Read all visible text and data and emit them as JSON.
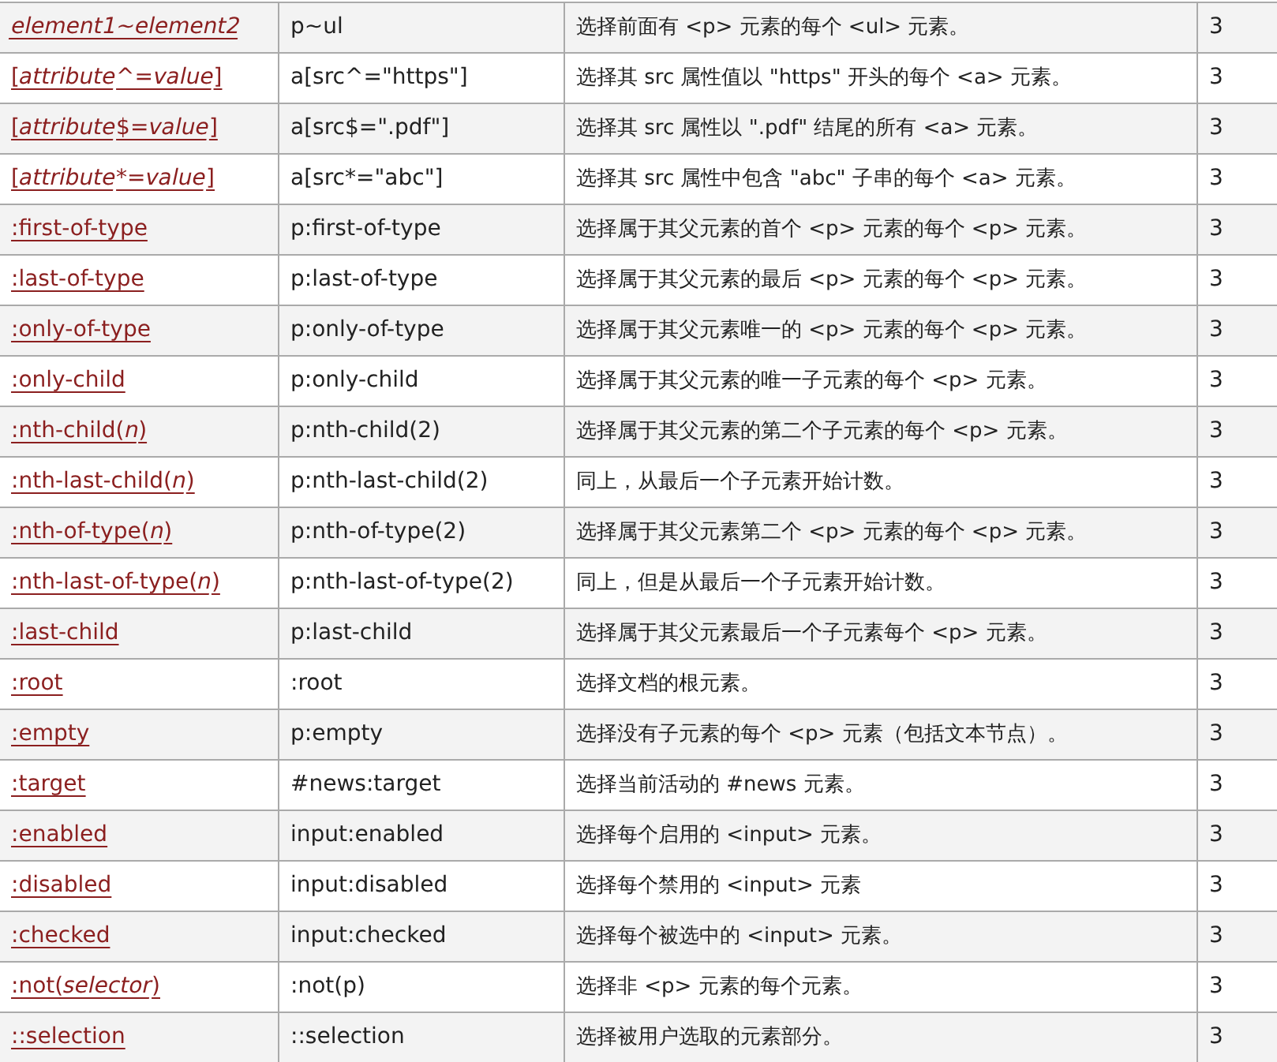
{
  "table": {
    "rows": [
      {
        "selector": [
          {
            "text": "element1~element2",
            "italic": true
          }
        ],
        "example": "p~ul",
        "description": "选择前面有 <p> 元素的每个 <ul> 元素。",
        "version": "3"
      },
      {
        "selector": [
          {
            "text": "[",
            "italic": false
          },
          {
            "text": "attribute",
            "italic": true
          },
          {
            "text": "^=",
            "italic": false
          },
          {
            "text": "value",
            "italic": true
          },
          {
            "text": "]",
            "italic": false
          }
        ],
        "example": "a[src^=\"https\"]",
        "description": "选择其 src 属性值以 \"https\" 开头的每个 <a> 元素。",
        "version": "3"
      },
      {
        "selector": [
          {
            "text": "[",
            "italic": false
          },
          {
            "text": "attribute",
            "italic": true
          },
          {
            "text": "$=",
            "italic": false
          },
          {
            "text": "value",
            "italic": true
          },
          {
            "text": "]",
            "italic": false
          }
        ],
        "example": "a[src$=\".pdf\"]",
        "description": "选择其 src 属性以 \".pdf\" 结尾的所有 <a> 元素。",
        "version": "3"
      },
      {
        "selector": [
          {
            "text": "[",
            "italic": false
          },
          {
            "text": "attribute",
            "italic": true
          },
          {
            "text": "*=",
            "italic": false
          },
          {
            "text": "value",
            "italic": true
          },
          {
            "text": "]",
            "italic": false
          }
        ],
        "example": "a[src*=\"abc\"]",
        "description": "选择其 src 属性中包含 \"abc\" 子串的每个 <a> 元素。",
        "version": "3"
      },
      {
        "selector": [
          {
            "text": ":first-of-type",
            "italic": false
          }
        ],
        "example": "p:first-of-type",
        "description": "选择属于其父元素的首个 <p> 元素的每个 <p> 元素。",
        "version": "3"
      },
      {
        "selector": [
          {
            "text": ":last-of-type",
            "italic": false
          }
        ],
        "example": "p:last-of-type",
        "description": "选择属于其父元素的最后 <p> 元素的每个 <p> 元素。",
        "version": "3"
      },
      {
        "selector": [
          {
            "text": ":only-of-type",
            "italic": false
          }
        ],
        "example": "p:only-of-type",
        "description": "选择属于其父元素唯一的 <p> 元素的每个 <p> 元素。",
        "version": "3"
      },
      {
        "selector": [
          {
            "text": ":only-child",
            "italic": false
          }
        ],
        "example": "p:only-child",
        "description": "选择属于其父元素的唯一子元素的每个 <p> 元素。",
        "version": "3"
      },
      {
        "selector": [
          {
            "text": ":nth-child(",
            "italic": false
          },
          {
            "text": "n",
            "italic": true
          },
          {
            "text": ")",
            "italic": false
          }
        ],
        "example": "p:nth-child(2)",
        "description": "选择属于其父元素的第二个子元素的每个 <p> 元素。",
        "version": "3"
      },
      {
        "selector": [
          {
            "text": ":nth-last-child(",
            "italic": false
          },
          {
            "text": "n",
            "italic": true
          },
          {
            "text": ")",
            "italic": false
          }
        ],
        "example": "p:nth-last-child(2)",
        "description": "同上，从最后一个子元素开始计数。",
        "version": "3"
      },
      {
        "selector": [
          {
            "text": ":nth-of-type(",
            "italic": false
          },
          {
            "text": "n",
            "italic": true
          },
          {
            "text": ")",
            "italic": false
          }
        ],
        "example": "p:nth-of-type(2)",
        "description": "选择属于其父元素第二个 <p> 元素的每个 <p> 元素。",
        "version": "3"
      },
      {
        "selector": [
          {
            "text": ":nth-last-of-type(",
            "italic": false
          },
          {
            "text": "n",
            "italic": true
          },
          {
            "text": ")",
            "italic": false
          }
        ],
        "example": "p:nth-last-of-type(2)",
        "description": "同上，但是从最后一个子元素开始计数。",
        "version": "3"
      },
      {
        "selector": [
          {
            "text": ":last-child",
            "italic": false
          }
        ],
        "example": "p:last-child",
        "description": "选择属于其父元素最后一个子元素每个 <p> 元素。",
        "version": "3"
      },
      {
        "selector": [
          {
            "text": ":root",
            "italic": false
          }
        ],
        "example": ":root",
        "description": "选择文档的根元素。",
        "version": "3"
      },
      {
        "selector": [
          {
            "text": ":empty",
            "italic": false
          }
        ],
        "example": "p:empty",
        "description": "选择没有子元素的每个 <p> 元素（包括文本节点）。",
        "version": "3"
      },
      {
        "selector": [
          {
            "text": ":target",
            "italic": false
          }
        ],
        "example": "#news:target",
        "description": "选择当前活动的 #news 元素。",
        "version": "3"
      },
      {
        "selector": [
          {
            "text": ":enabled",
            "italic": false
          }
        ],
        "example": "input:enabled",
        "description": "选择每个启用的 <input> 元素。",
        "version": "3"
      },
      {
        "selector": [
          {
            "text": ":disabled",
            "italic": false
          }
        ],
        "example": "input:disabled",
        "description": "选择每个禁用的 <input> 元素",
        "version": "3"
      },
      {
        "selector": [
          {
            "text": ":checked",
            "italic": false
          }
        ],
        "example": "input:checked",
        "description": "选择每个被选中的 <input> 元素。",
        "version": "3"
      },
      {
        "selector": [
          {
            "text": ":not(",
            "italic": false
          },
          {
            "text": "selector",
            "italic": true
          },
          {
            "text": ")",
            "italic": false
          }
        ],
        "example": ":not(p)",
        "description": "选择非 <p> 元素的每个元素。",
        "version": "3"
      },
      {
        "selector": [
          {
            "text": "::selection",
            "italic": false
          }
        ],
        "example": "::selection",
        "description": "选择被用户选取的元素部分。",
        "version": "3"
      }
    ]
  }
}
